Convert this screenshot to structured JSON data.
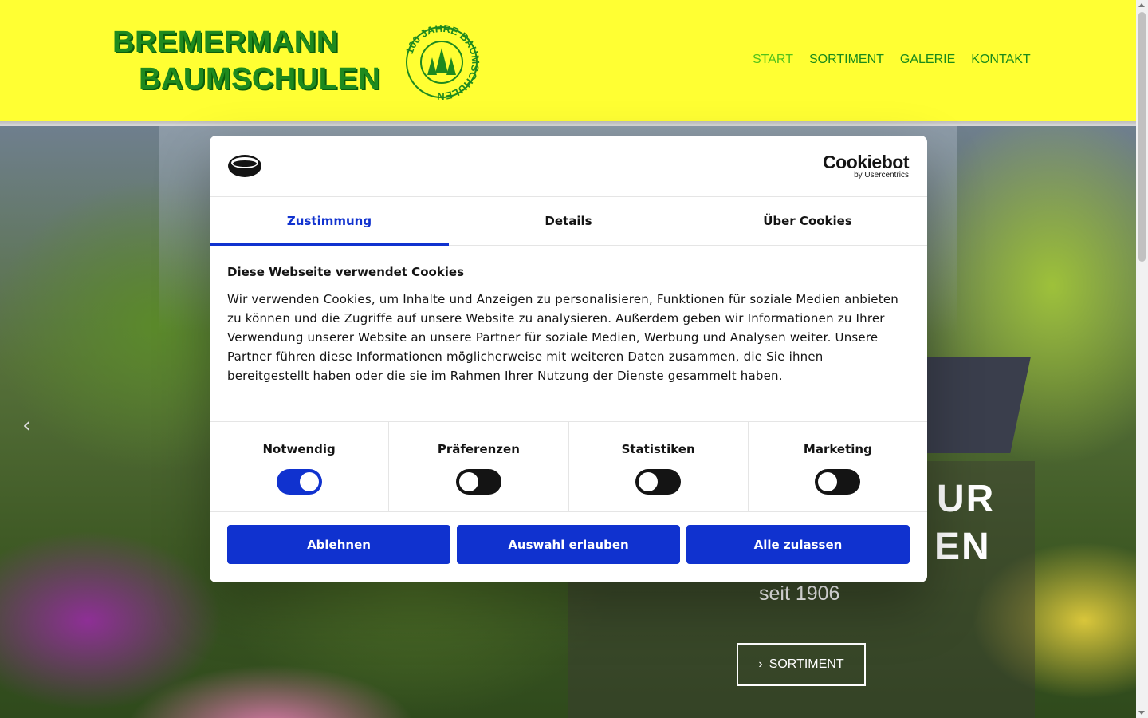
{
  "header": {
    "brand_line1": "BREMERMANN",
    "brand_line2": "BAUMSCHULEN",
    "seal_text": "100 JAHRE BAUMSCHULEN",
    "nav": [
      {
        "label": "START",
        "active": true
      },
      {
        "label": "SORTIMENT",
        "active": false
      },
      {
        "label": "GALERIE",
        "active": false
      },
      {
        "label": "KONTAKT",
        "active": false
      }
    ],
    "colors": {
      "background": "#ffff33",
      "nav_text": "#1a8a1a",
      "nav_active": "#52c21a"
    }
  },
  "hero": {
    "title_fragment_1": "UR",
    "title_fragment_2": "EN",
    "subtitle": "seit 1906",
    "button_label": "SORTIMENT",
    "prev_icon": "chevron-left-icon"
  },
  "cookie_dialog": {
    "brand": "Cookiebot",
    "brand_by": "by Usercentrics",
    "tabs": [
      {
        "label": "Zustimmung",
        "active": true
      },
      {
        "label": "Details",
        "active": false
      },
      {
        "label": "Über Cookies",
        "active": false
      }
    ],
    "title": "Diese Webseite verwendet Cookies",
    "text": "Wir verwenden Cookies, um Inhalte und Anzeigen zu personalisieren, Funktionen für soziale Medien anbieten zu können und die Zugriffe auf unsere Website zu analysieren. Außerdem geben wir Informationen zu Ihrer Verwendung unserer Website an unsere Partner für soziale Medien, Werbung und Analysen weiter. Unsere Partner führen diese Informationen möglicherweise mit weiteren Daten zusammen, die Sie ihnen bereitgestellt haben oder die sie im Rahmen Ihrer Nutzung der Dienste gesammelt haben.",
    "toggles": [
      {
        "label": "Notwendig",
        "checked": true
      },
      {
        "label": "Präferenzen",
        "checked": false
      },
      {
        "label": "Statistiken",
        "checked": false
      },
      {
        "label": "Marketing",
        "checked": false
      }
    ],
    "buttons": {
      "decline": "Ablehnen",
      "allow_selection": "Auswahl erlauben",
      "allow_all": "Alle zulassen"
    },
    "colors": {
      "accent": "#1032cf"
    }
  }
}
